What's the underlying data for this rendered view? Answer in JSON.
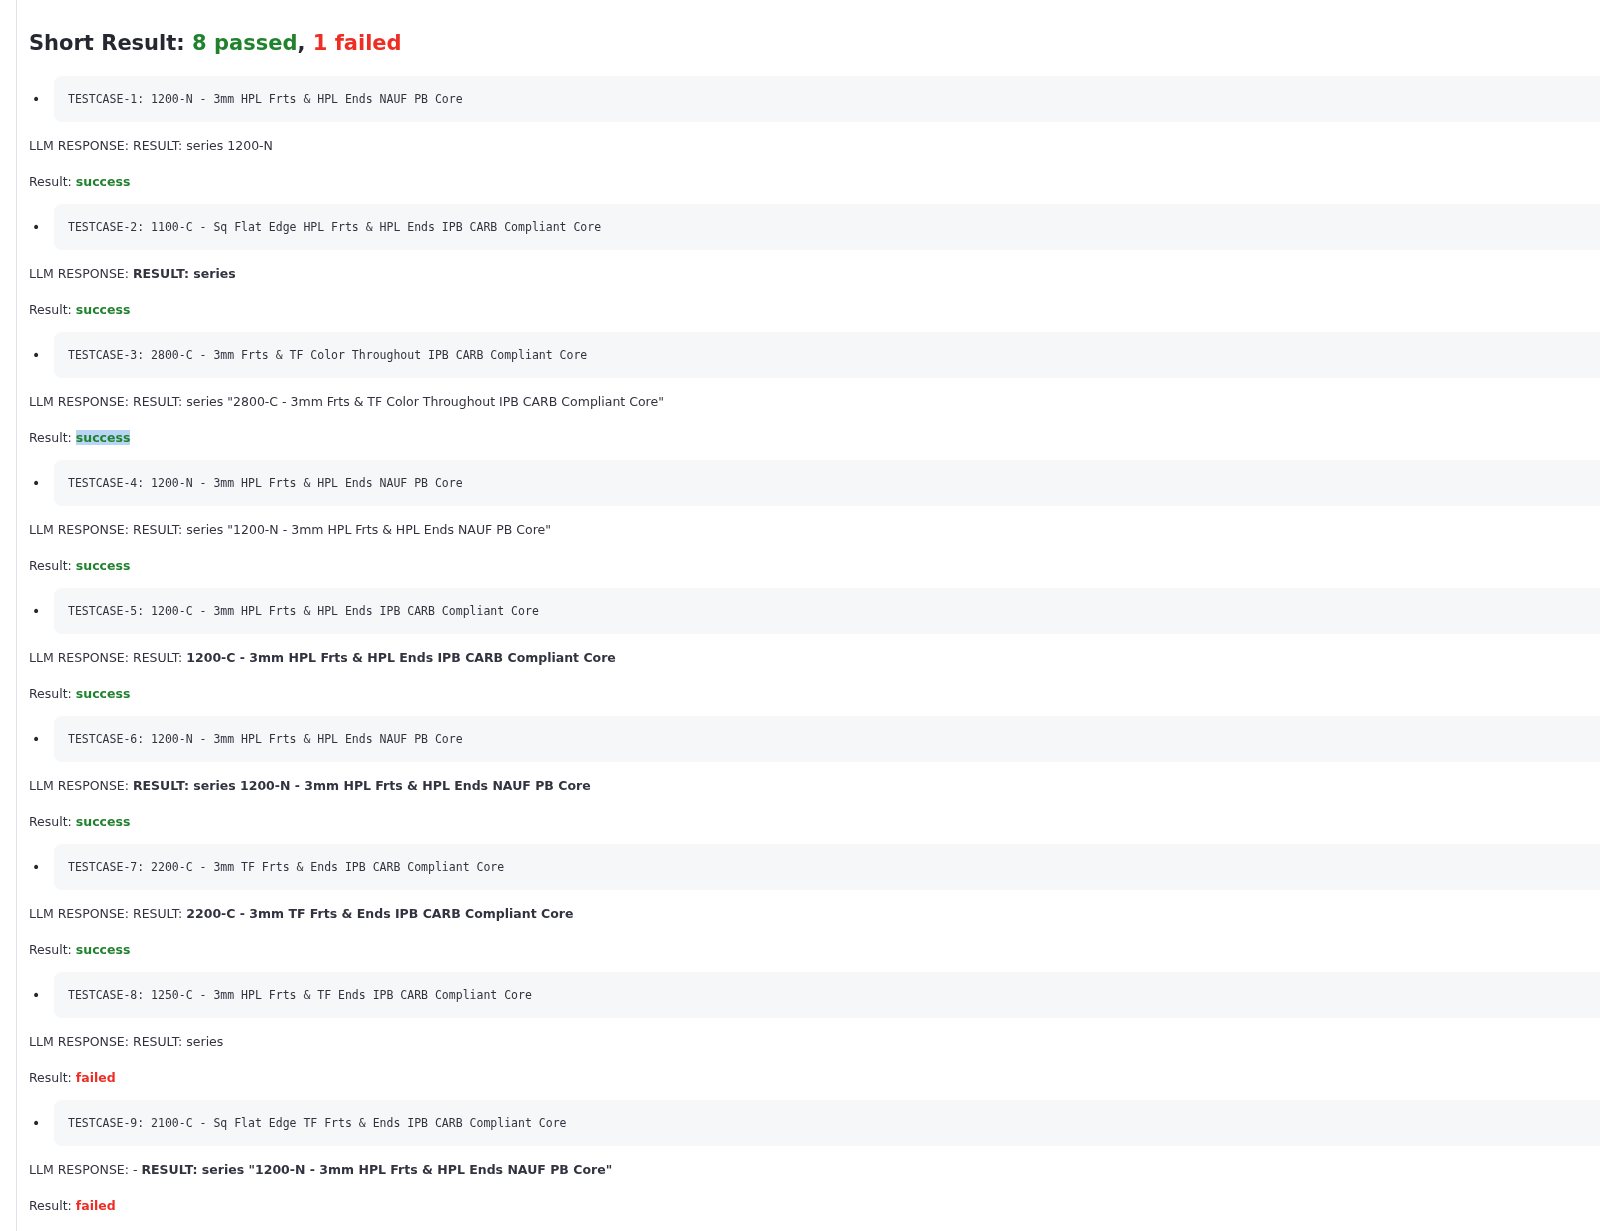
{
  "summary": {
    "label": "Short Result:",
    "passed": "8 passed",
    "separator": ",",
    "failed": "1 failed"
  },
  "testcases": [
    {
      "bullet": "•",
      "code": "TESTCASE-1: 1200-N - 3mm HPL Frts & HPL Ends NAUF PB Core",
      "response": "LLM RESPONSE: RESULT: series 1200-N",
      "result_label": "Result:",
      "status": "success",
      "kind": "success",
      "highlighted": false
    },
    {
      "bullet": "•",
      "code": "TESTCASE-2: 1100-C - Sq Flat Edge HPL Frts & HPL Ends IPB CARB Compliant Core",
      "response": "LLM RESPONSE: **RESULT: series**",
      "result_label": "Result:",
      "status": "success",
      "kind": "success",
      "highlighted": false
    },
    {
      "bullet": "•",
      "code": "TESTCASE-3: 2800-C - 3mm Frts & TF Color Throughout IPB CARB Compliant Core",
      "response": "LLM RESPONSE: RESULT: series \"2800-C - 3mm Frts & TF Color Throughout IPB CARB Compliant Core\"",
      "result_label": "Result:",
      "status": "success",
      "kind": "success",
      "highlighted": true
    },
    {
      "bullet": "•",
      "code": "TESTCASE-4: 1200-N - 3mm HPL Frts & HPL Ends NAUF PB Core",
      "response": "LLM RESPONSE: RESULT: series \"1200-N - 3mm HPL Frts & HPL Ends NAUF PB Core\"",
      "result_label": "Result:",
      "status": "success",
      "kind": "success",
      "highlighted": false
    },
    {
      "bullet": "•",
      "code": "TESTCASE-5: 1200-C - 3mm HPL Frts & HPL Ends IPB CARB Compliant Core",
      "response": "LLM RESPONSE: RESULT: **1200-C - 3mm HPL Frts & HPL Ends IPB CARB Compliant Core**",
      "result_label": "Result:",
      "status": "success",
      "kind": "success",
      "highlighted": false
    },
    {
      "bullet": "•",
      "code": "TESTCASE-6: 1200-N - 3mm HPL Frts & HPL Ends NAUF PB Core",
      "response": "LLM RESPONSE: **RESULT: series 1200-N - 3mm HPL Frts & HPL Ends NAUF PB Core**",
      "result_label": "Result:",
      "status": "success",
      "kind": "success",
      "highlighted": false
    },
    {
      "bullet": "•",
      "code": "TESTCASE-7: 2200-C - 3mm TF Frts & Ends IPB CARB Compliant Core",
      "response": "LLM RESPONSE: RESULT: **2200-C - 3mm TF Frts & Ends IPB CARB Compliant Core**",
      "result_label": "Result:",
      "status": "success",
      "kind": "success",
      "highlighted": false
    },
    {
      "bullet": "•",
      "code": "TESTCASE-8: 1250-C - 3mm HPL Frts & TF Ends IPB CARB Compliant Core",
      "response": "LLM RESPONSE: RESULT: series",
      "result_label": "Result:",
      "status": "failed",
      "kind": "failed",
      "highlighted": false
    },
    {
      "bullet": "•",
      "code": "TESTCASE-9: 2100-C - Sq Flat Edge TF Frts & Ends IPB CARB Compliant Core",
      "response": "LLM RESPONSE: - **RESULT: series \"1200-N - 3mm HPL Frts & HPL Ends NAUF PB Core\"**",
      "result_label": "Result:",
      "status": "failed",
      "kind": "failed",
      "highlighted": false
    }
  ]
}
